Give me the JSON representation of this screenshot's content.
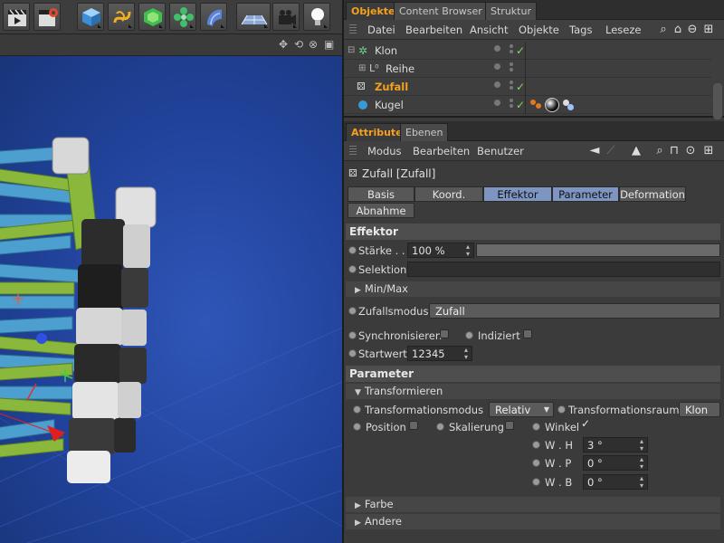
{
  "toolbar": {
    "icons": [
      "clapper-render-icon",
      "clapper-settings-icon",
      "cube-icon",
      "spline-icon",
      "nurbs-icon",
      "mograph-cloner-icon",
      "deformer-icon",
      "floor-grid-icon",
      "camera-icon",
      "light-bulb-icon"
    ]
  },
  "viewport": {
    "nav_icons": [
      "move-view-icon",
      "rotate-view-icon",
      "zoom-view-icon",
      "maximize-view-icon"
    ]
  },
  "objects_panel": {
    "tabs": [
      "Objekte",
      "Content Browser",
      "Struktur"
    ],
    "menu": [
      "Datei",
      "Bearbeiten",
      "Ansicht",
      "Objekte",
      "Tags",
      "Leseze"
    ],
    "items": [
      {
        "name": "Klon",
        "icon": "cloner-icon",
        "checked": true
      },
      {
        "name": "Reihe",
        "icon": "null-object-icon",
        "checked": false
      },
      {
        "name": "Zufall",
        "icon": "random-effector-icon",
        "checked": true
      },
      {
        "name": "Kugel",
        "icon": "sphere-icon",
        "checked": true
      }
    ]
  },
  "attributes_panel": {
    "tabs": [
      "Attribute",
      "Ebenen"
    ],
    "menu": [
      "Modus",
      "Bearbeiten",
      "Benutzer"
    ],
    "object_title": "Zufall [Zufall]",
    "tab_buttons": [
      {
        "label": "Basis",
        "selected": false
      },
      {
        "label": "Koord.",
        "selected": false
      },
      {
        "label": "Effektor",
        "selected": true
      },
      {
        "label": "Parameter",
        "selected": true
      },
      {
        "label": "Deformation",
        "selected": false
      },
      {
        "label": "Abnahme",
        "selected": false
      }
    ],
    "effektor": {
      "header": "Effektor",
      "staerke_label": "Stärke . .",
      "staerke_value": "100 %",
      "staerke_fraction": 1.0,
      "selektion_label": "Selektion",
      "selektion_value": "",
      "minmax_label": "Min/Max",
      "zufallsmodus_label": "Zufallsmodus",
      "zufallsmodus_value": "Zufall",
      "synchronisieren_label": "Synchronisieren",
      "indiziert_label": "Indiziert",
      "startwert_label": "Startwert",
      "startwert_value": "12345"
    },
    "parameter": {
      "header": "Parameter",
      "transformieren_label": "Transformieren",
      "transformationsmodus_label": "Transformationsmodus",
      "transformationsmodus_value": "Relativ",
      "transformationsraum_label": "Transformationsraum",
      "transformationsraum_value": "Klon",
      "position_label": "Position",
      "skalierung_label": "Skalierung",
      "winkel_label": "Winkel",
      "winkel_checked": true,
      "wh_label": "W . H",
      "wh_value": "3 °",
      "wp_label": "W . P",
      "wp_value": "0 °",
      "wb_label": "W . B",
      "wb_value": "0 °",
      "farbe_label": "Farbe",
      "andere_label": "Andere"
    }
  }
}
